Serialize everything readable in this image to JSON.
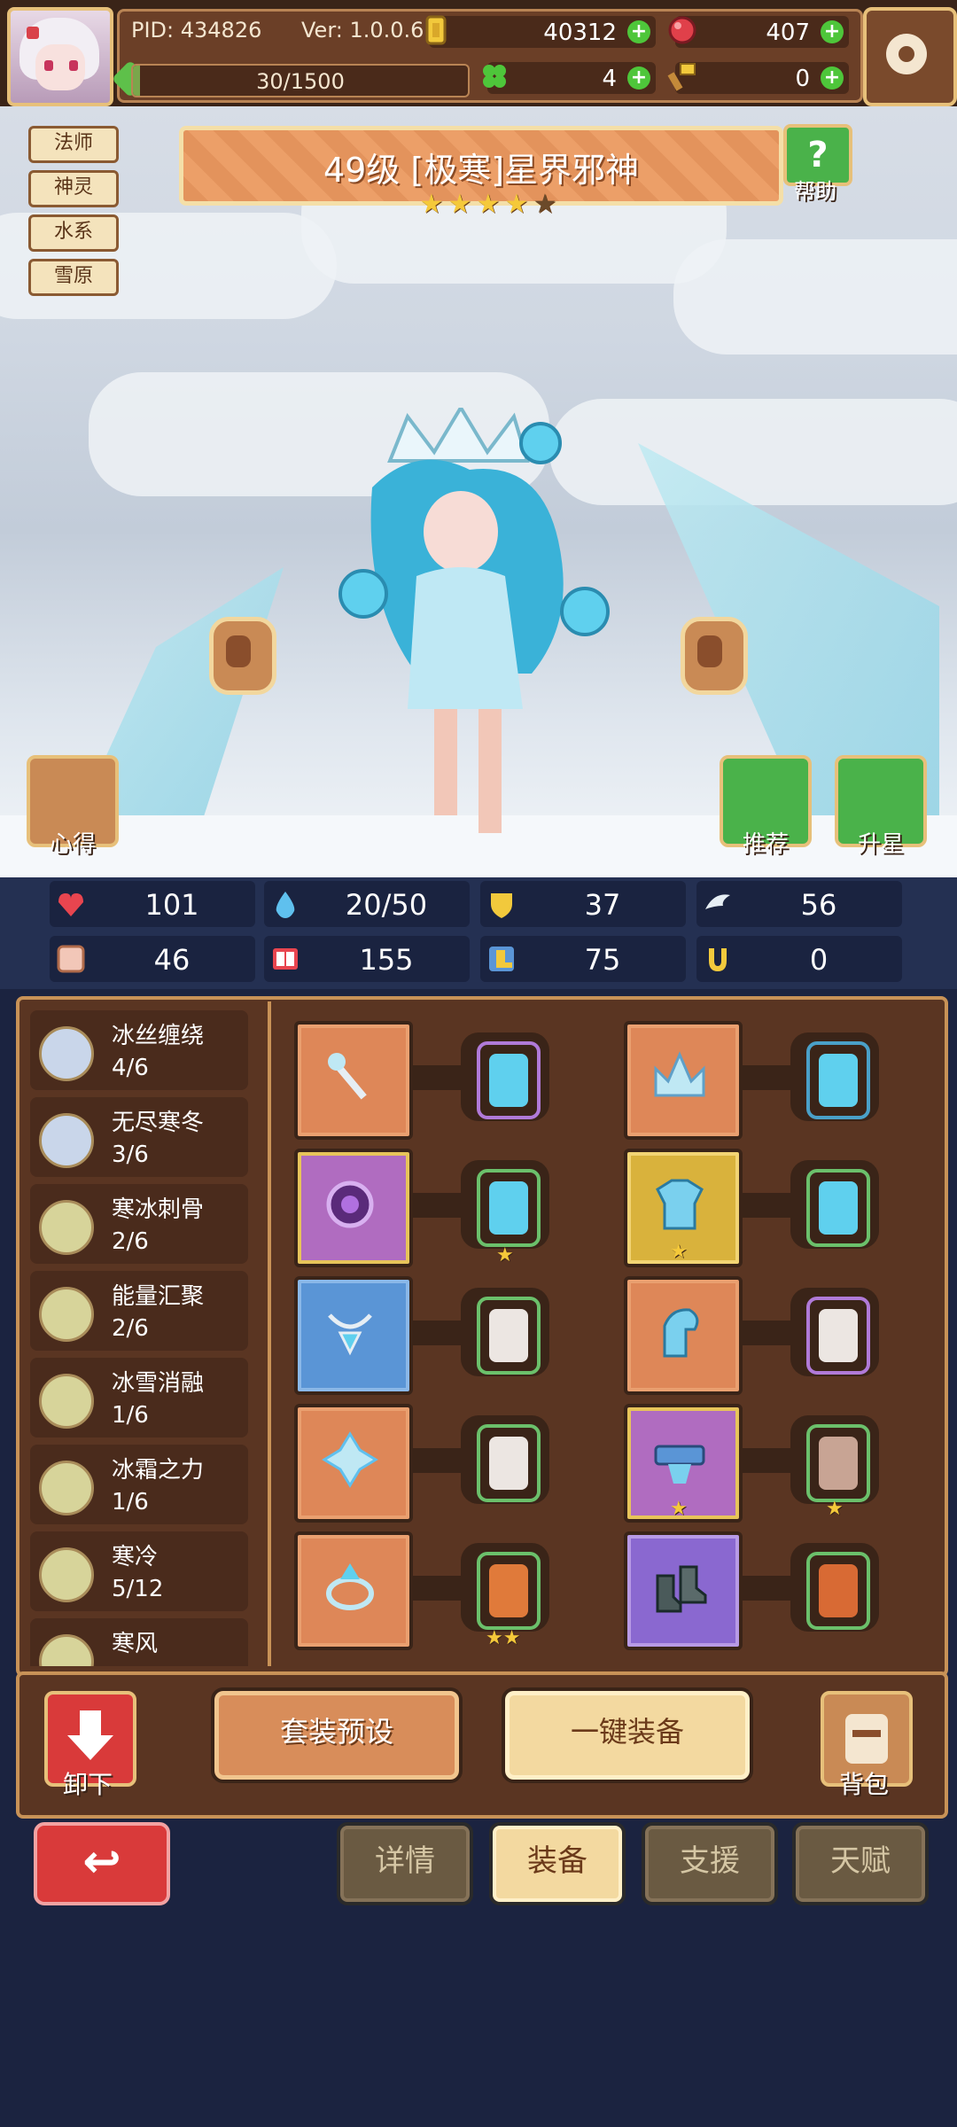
{
  "header": {
    "pid": "PID: 434826",
    "version": "Ver: 1.0.0.6",
    "gold": "40312",
    "gems": "407",
    "clover": "4",
    "hammer": "0",
    "xp": "30/1500",
    "xp_fraction": 0.02
  },
  "hero": {
    "tags": [
      "法师",
      "神灵",
      "水系",
      "雪原"
    ],
    "title": "49级 [极寒]星界邪神",
    "stars": 4,
    "max_stars": 5,
    "help_label": "帮助",
    "notes_label": "心得",
    "recommend_label": "推荐",
    "upgrade_label": "升星"
  },
  "stats": [
    "101",
    "20/50",
    "37",
    "56",
    "46",
    "155",
    "75",
    "0"
  ],
  "skills": [
    {
      "name": "冰丝缠绕",
      "level": "4/6"
    },
    {
      "name": "无尽寒冬",
      "level": "3/6"
    },
    {
      "name": "寒冰刺骨",
      "level": "2/6"
    },
    {
      "name": "能量汇聚",
      "level": "2/6"
    },
    {
      "name": "冰雪消融",
      "level": "1/6"
    },
    {
      "name": "冰霜之力",
      "level": "1/6"
    },
    {
      "name": "寒冷",
      "level": "5/12"
    },
    {
      "name": "寒风",
      "level": ""
    }
  ],
  "actions": {
    "unequip": "卸下",
    "preset": "套装预设",
    "equip_all": "一键装备",
    "bag": "背包"
  },
  "tabs": [
    "详情",
    "装备",
    "支援",
    "天赋"
  ],
  "active_tab": "装备",
  "colors": {
    "accent_gold": "#e7c07a",
    "panel_brown": "#5a3522",
    "back_red": "#d93a3a",
    "plus_green": "#4ec63a"
  }
}
